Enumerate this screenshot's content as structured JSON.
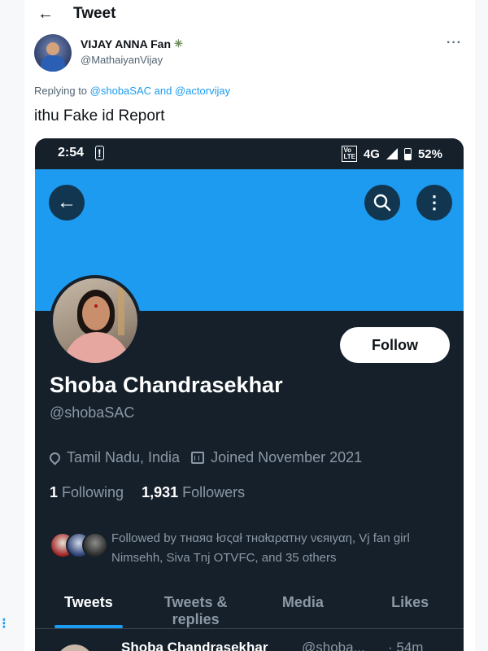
{
  "header": {
    "title": "Tweet"
  },
  "tweet": {
    "author_name": "VIJAY ANNA Fan",
    "author_handle": "@MathaiyanVijay",
    "replying_prefix": "Replying to",
    "reply_to_1": "@shobaSAC",
    "reply_join": "and",
    "reply_to_2": "@actorvijay",
    "text": "ithu Fake id Report"
  },
  "screenshot": {
    "status_bar": {
      "time": "2:54",
      "network": "4G",
      "battery": "52%"
    },
    "profile": {
      "follow_label": "Follow",
      "name": "Shoba Chandrasekhar",
      "handle": "@shobaSAC",
      "location": "Tamil Nadu, India",
      "joined": "Joined November 2021",
      "following_count": "1",
      "following_label": "Following",
      "followers_count": "1,931",
      "followers_label": "Followers",
      "followed_by": "Followed by тнαяα łσςαł тнαłαραтну νєяιуαη, Vj fan girl Nimsehh, Siva Tnj OTVFC, and 35 others"
    },
    "tabs": [
      "Tweets",
      "Tweets & replies",
      "Media",
      "Likes"
    ],
    "next_tweet": {
      "name": "Shoba Chandrasekhar",
      "handle": "@shoba...",
      "time": "· 54m"
    }
  }
}
